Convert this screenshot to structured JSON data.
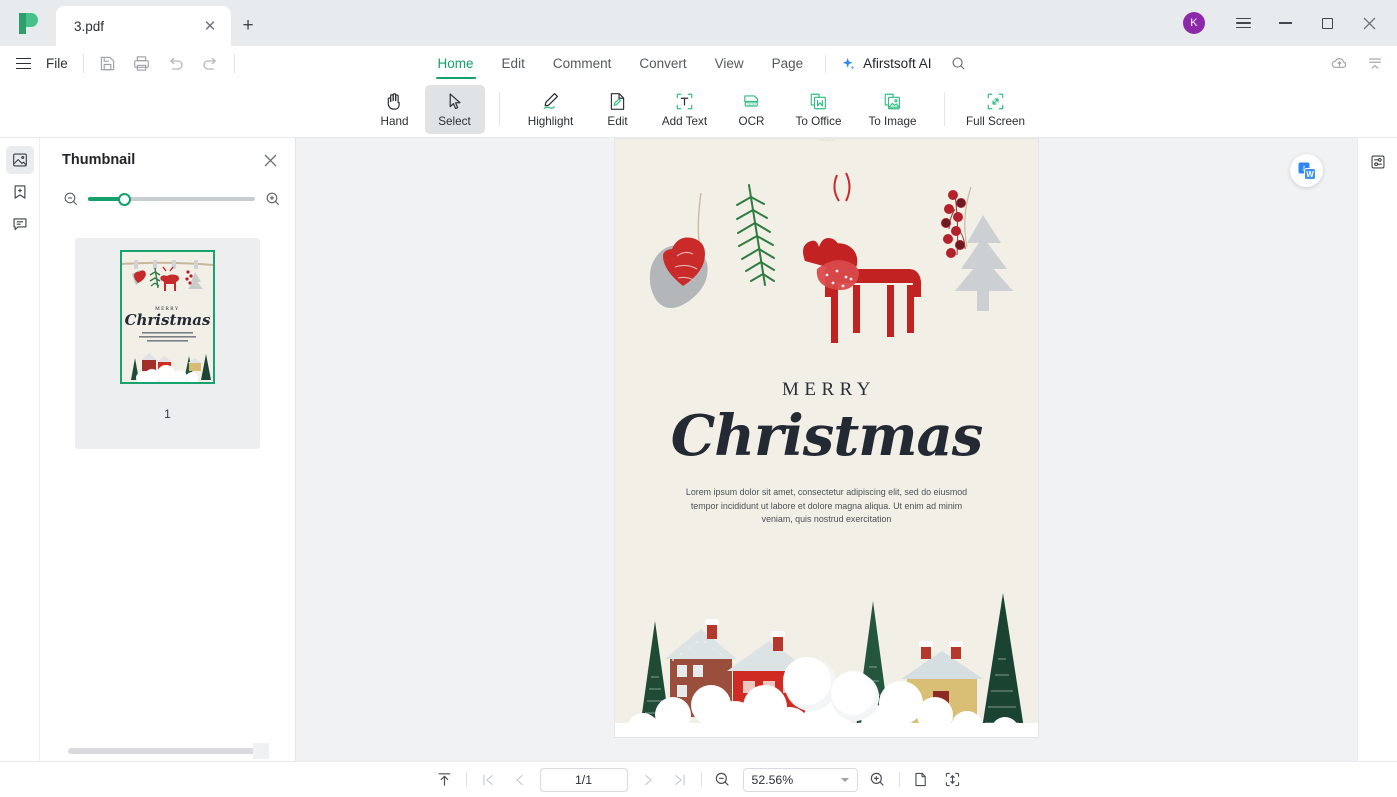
{
  "window": {
    "app_logo": "afirstsoft-logo",
    "tab_title": "3.pdf",
    "tab_close_icon": "close-icon",
    "new_tab_icon": "plus-icon",
    "avatar_initial": "K",
    "avatar_color": "#8c29ab",
    "menu_icon": "hamburger-icon",
    "minimize_icon": "minimize-icon",
    "maximize_icon": "maximize-icon",
    "close_icon": "close-icon"
  },
  "menubar": {
    "app_menu_icon": "hamburger-icon",
    "file_label": "File",
    "quick_actions": [
      {
        "name": "save-icon",
        "label": "Save"
      },
      {
        "name": "print-icon",
        "label": "Print"
      },
      {
        "name": "undo-icon",
        "label": "Undo"
      },
      {
        "name": "redo-icon",
        "label": "Redo"
      }
    ],
    "tabs": [
      {
        "label": "Home",
        "active": true
      },
      {
        "label": "Edit",
        "active": false
      },
      {
        "label": "Comment",
        "active": false
      },
      {
        "label": "Convert",
        "active": false
      },
      {
        "label": "View",
        "active": false
      },
      {
        "label": "Page",
        "active": false
      }
    ],
    "ai_label": "Afirstsoft AI",
    "ai_icon": "sparkle-icon",
    "search_icon": "search-icon",
    "cloud_icon": "cloud-upload-icon",
    "collapse_icon": "collapse-ribbon-icon",
    "accent_color": "#13a06b"
  },
  "toolbar": {
    "items": [
      {
        "label": "Hand",
        "icon": "hand-icon",
        "active": false
      },
      {
        "label": "Select",
        "icon": "cursor-arrow-icon",
        "active": true
      },
      {
        "label": "Highlight",
        "icon": "highlighter-icon",
        "active": false
      },
      {
        "label": "Edit",
        "icon": "edit-page-icon",
        "active": false
      },
      {
        "label": "Add Text",
        "icon": "add-text-icon",
        "active": false
      },
      {
        "label": "OCR",
        "icon": "ocr-icon",
        "active": false
      },
      {
        "label": "To Office",
        "icon": "to-office-icon",
        "active": false
      },
      {
        "label": "To Image",
        "icon": "to-image-icon",
        "active": false
      },
      {
        "label": "Full Screen",
        "icon": "full-screen-icon",
        "active": false
      }
    ]
  },
  "rail": {
    "items": [
      {
        "name": "thumbnail-panel-icon",
        "active": true
      },
      {
        "name": "bookmark-add-icon",
        "active": false
      },
      {
        "name": "comment-panel-icon",
        "active": false
      }
    ]
  },
  "panel": {
    "title": "Thumbnail",
    "close_icon": "close-icon",
    "zoom_out_icon": "zoom-out-icon",
    "zoom_in_icon": "zoom-in-icon",
    "slider_value": 22,
    "thumbnails": [
      {
        "page_number": "1",
        "selected": true
      }
    ]
  },
  "document": {
    "float_convert_icon": "pdf-to-word-icon",
    "properties_icon": "properties-panel-icon",
    "page": {
      "heading_small": "MERRY",
      "heading_large": "Christmas",
      "body_text": "Lorem ipsum dolor sit amet, consectetur adipiscing elit, sed do eiusmod tempor incididunt ut labore et dolore magna aliqua. Ut enim ad minim veniam, quis nostrud exercitation",
      "background_color": "#f2efe6",
      "ornaments": [
        "heart-ornament",
        "pine-branch",
        "reindeer-ornament",
        "berry-tree-ornament"
      ],
      "scene": "snow-village-scene"
    }
  },
  "bottombar": {
    "scroll_top_icon": "scroll-to-top-icon",
    "first_page_icon": "first-page-icon",
    "prev_page_icon": "previous-page-icon",
    "page_indicator": "1/1",
    "next_page_icon": "next-page-icon",
    "last_page_icon": "last-page-icon",
    "zoom_out_icon": "zoom-out-icon",
    "zoom_value": "52.56%",
    "zoom_dropdown_icon": "chevron-down-icon",
    "zoom_in_icon": "zoom-in-icon",
    "single_page_icon": "single-page-view-icon",
    "fit_page_icon": "fit-page-icon"
  }
}
